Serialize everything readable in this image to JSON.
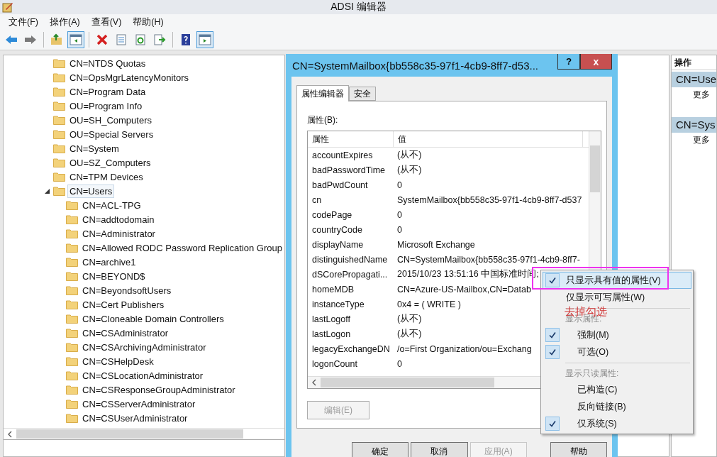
{
  "window": {
    "title": "ADSI 编辑器"
  },
  "menu": [
    "文件(F)",
    "操作(A)",
    "查看(V)",
    "帮助(H)"
  ],
  "toolbar": [
    {
      "kind": "back",
      "on": false
    },
    {
      "kind": "forward",
      "on": false
    },
    {
      "kind": "sep"
    },
    {
      "kind": "up",
      "on": false
    },
    {
      "kind": "tree",
      "on": true
    },
    {
      "kind": "sep"
    },
    {
      "kind": "delete",
      "on": false
    },
    {
      "kind": "properties",
      "on": false
    },
    {
      "kind": "refresh",
      "on": false
    },
    {
      "kind": "export",
      "on": false
    },
    {
      "kind": "sep"
    },
    {
      "kind": "help",
      "on": false
    },
    {
      "kind": "pane",
      "on": true
    }
  ],
  "tree": [
    {
      "label": "CN=NTDS Quotas",
      "selected": false
    },
    {
      "label": "CN=OpsMgrLatencyMonitors",
      "selected": false
    },
    {
      "label": "CN=Program Data",
      "selected": false
    },
    {
      "label": "OU=Program Info",
      "selected": false
    },
    {
      "label": "OU=SH_Computers",
      "selected": false
    },
    {
      "label": "OU=Special Servers",
      "selected": false
    },
    {
      "label": "CN=System",
      "selected": false
    },
    {
      "label": "OU=SZ_Computers",
      "selected": false
    },
    {
      "label": "CN=TPM Devices",
      "selected": false
    },
    {
      "label": "CN=Users",
      "selected": true,
      "expanded": true,
      "children": [
        {
          "label": "CN=ACL-TPG",
          "selected": false
        },
        {
          "label": "CN=addtodomain",
          "selected": false
        },
        {
          "label": "CN=Administrator",
          "selected": false
        },
        {
          "label": "CN=Allowed RODC Password Replication Group",
          "selected": false
        },
        {
          "label": "CN=archive1",
          "selected": false
        },
        {
          "label": "CN=BEYOND$",
          "selected": false
        },
        {
          "label": "CN=BeyondsoftUsers",
          "selected": false
        },
        {
          "label": "CN=Cert Publishers",
          "selected": false
        },
        {
          "label": "CN=Cloneable Domain Controllers",
          "selected": false
        },
        {
          "label": "CN=CSAdministrator",
          "selected": false
        },
        {
          "label": "CN=CSArchivingAdministrator",
          "selected": false
        },
        {
          "label": "CN=CSHelpDesk",
          "selected": false
        },
        {
          "label": "CN=CSLocationAdministrator",
          "selected": false
        },
        {
          "label": "CN=CSResponseGroupAdministrator",
          "selected": false
        },
        {
          "label": "CN=CSServerAdministrator",
          "selected": false
        },
        {
          "label": "CN=CSUserAdministrator",
          "selected": false
        }
      ]
    }
  ],
  "dialog": {
    "title": "CN=SystemMailbox{bb558c35-97f1-4cb9-8ff7-d53...",
    "help": "?",
    "close": "x",
    "tabs": [
      {
        "label": "属性编辑器",
        "selected": true
      },
      {
        "label": "安全",
        "selected": false
      }
    ],
    "list_label": "属性(B):",
    "columns": [
      "属性",
      "值"
    ],
    "rows": [
      {
        "attribute": "accountExpires",
        "value": "(从不)"
      },
      {
        "attribute": "badPasswordTime",
        "value": "(从不)"
      },
      {
        "attribute": "badPwdCount",
        "value": "0"
      },
      {
        "attribute": "cn",
        "value": "SystemMailbox{bb558c35-97f1-4cb9-8ff7-d537"
      },
      {
        "attribute": "codePage",
        "value": "0"
      },
      {
        "attribute": "countryCode",
        "value": "0"
      },
      {
        "attribute": "displayName",
        "value": "Microsoft Exchange"
      },
      {
        "attribute": "distinguishedName",
        "value": "CN=SystemMailbox{bb558c35-97f1-4cb9-8ff7-"
      },
      {
        "attribute": "dSCorePropagati...",
        "value": "2015/10/23 13:51:16 中国标准时间;"
      },
      {
        "attribute": "homeMDB",
        "value": "CN=Azure-US-Mailbox,CN=Datab"
      },
      {
        "attribute": "instanceType",
        "value": "0x4 = ( WRITE )"
      },
      {
        "attribute": "lastLogoff",
        "value": "(从不)"
      },
      {
        "attribute": "lastLogon",
        "value": "(从不)"
      },
      {
        "attribute": "legacyExchangeDN",
        "value": "/o=First Organization/ou=Exchang"
      },
      {
        "attribute": "logonCount",
        "value": "0"
      }
    ],
    "edit_button": {
      "label": "编辑(E)",
      "disabled": true
    },
    "buttons": [
      {
        "label": "确定",
        "disabled": false
      },
      {
        "label": "取消",
        "disabled": false
      },
      {
        "label": "应用(A)",
        "disabled": true
      },
      {
        "label": "帮助",
        "disabled": false
      }
    ]
  },
  "context_menu": [
    {
      "kind": "item",
      "label": "只显示具有值的属性(V)",
      "checked": true,
      "selected": true
    },
    {
      "kind": "item",
      "label": "仅显示可写属性(W)",
      "checked": false,
      "selected": false
    },
    {
      "kind": "separator"
    },
    {
      "kind": "header",
      "label": "显示属性:"
    },
    {
      "kind": "subitem",
      "label": "强制(M)",
      "checked": true,
      "selected": false
    },
    {
      "kind": "subitem",
      "label": "可选(O)",
      "checked": true,
      "selected": false
    },
    {
      "kind": "separator"
    },
    {
      "kind": "header",
      "label": "显示只读属性:"
    },
    {
      "kind": "subitem",
      "label": "已构造(C)",
      "checked": false,
      "selected": false
    },
    {
      "kind": "subitem",
      "label": "反向链接(B)",
      "checked": false,
      "selected": false
    },
    {
      "kind": "subitem",
      "label": "仅系统(S)",
      "checked": true,
      "selected": false
    }
  ],
  "annotation": {
    "text": "去掉勾选"
  },
  "actions_pane": {
    "title": "操作",
    "sections": [
      {
        "title": "CN=Use",
        "items": [
          "更多"
        ]
      },
      {
        "title": "CN=Sys",
        "items": [
          "更多"
        ]
      }
    ]
  }
}
